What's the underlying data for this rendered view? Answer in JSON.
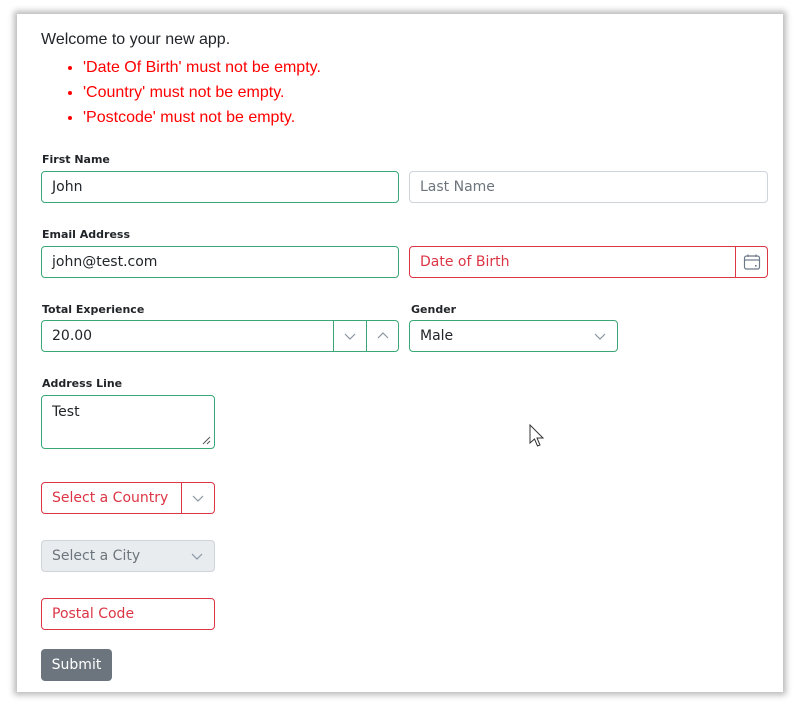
{
  "header": {
    "welcome": "Welcome to your new app."
  },
  "validation_errors": [
    "'Date Of Birth' must not be empty.",
    "'Country' must not be empty.",
    "'Postcode' must not be empty."
  ],
  "form": {
    "first_name": {
      "label": "First Name",
      "value": "John",
      "state": "valid"
    },
    "last_name": {
      "placeholder": "Last Name",
      "value": ""
    },
    "email": {
      "label": "Email Address",
      "value": "john@test.com",
      "state": "valid"
    },
    "date_of_birth": {
      "placeholder": "Date of Birth",
      "icon": "calendar-icon",
      "state": "invalid"
    },
    "total_experience": {
      "label": "Total Experience",
      "value": "20.00",
      "state": "valid"
    },
    "gender": {
      "label": "Gender",
      "value": "Male",
      "state": "valid"
    },
    "address_line": {
      "label": "Address Line",
      "value": "Test",
      "state": "valid"
    },
    "country": {
      "placeholder": "Select a Country",
      "state": "invalid"
    },
    "city": {
      "placeholder": "Select a City",
      "state": "disabled"
    },
    "postal_code": {
      "placeholder": "Postal Code",
      "state": "invalid"
    },
    "submit_label": "Submit"
  },
  "colors": {
    "valid": "#3aa776",
    "invalid": "#dc3545",
    "error_text": "#ff0000",
    "button": "#6c757d"
  }
}
